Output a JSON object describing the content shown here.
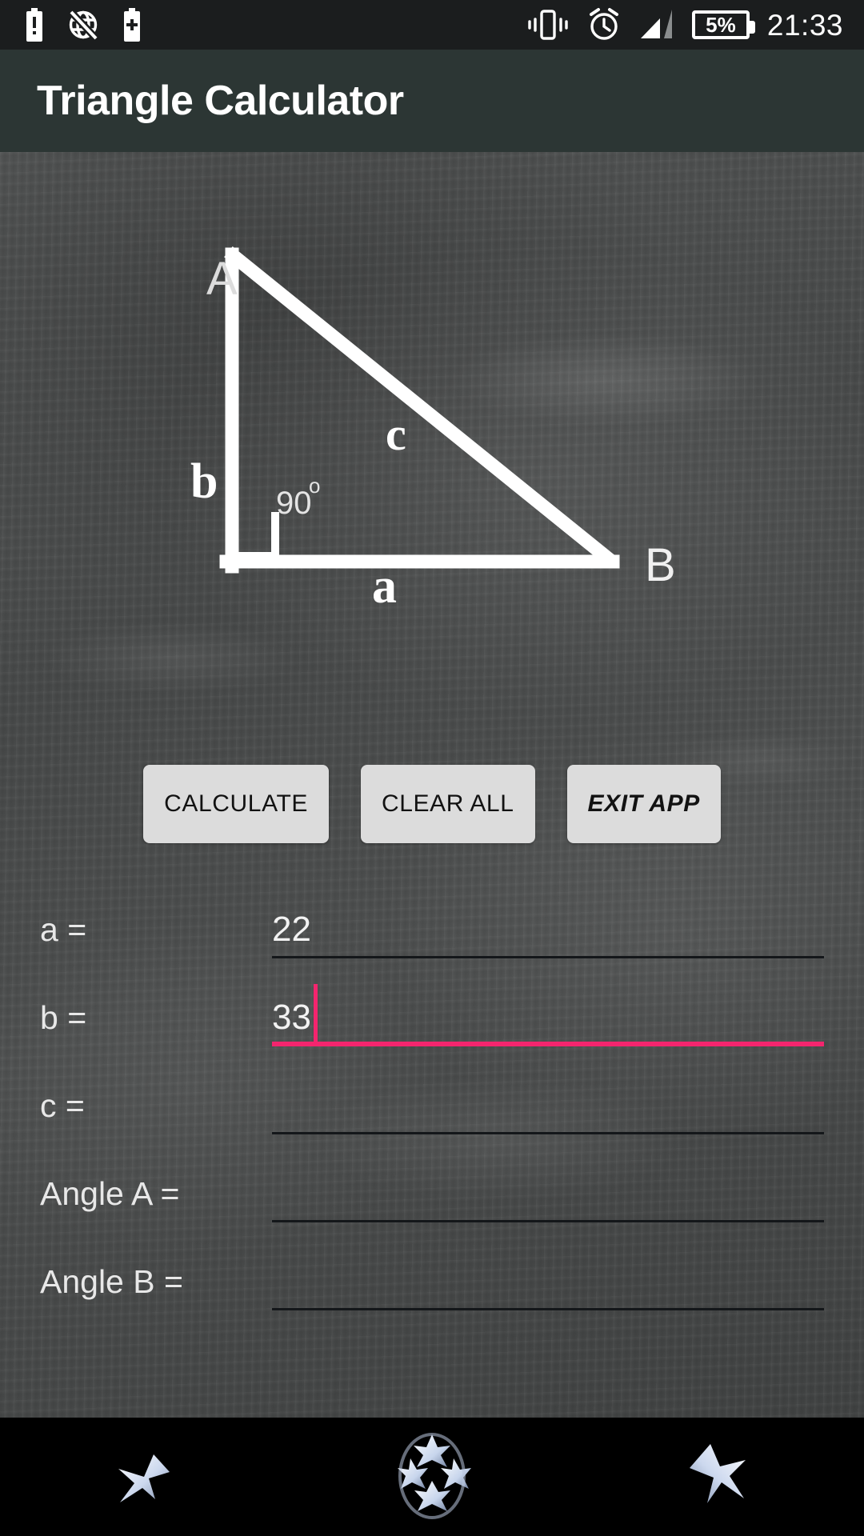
{
  "status_bar": {
    "icons_left": [
      "battery-alert-icon",
      "no-internet-icon",
      "battery-plus-icon"
    ],
    "icons_right": [
      "vibrate-icon",
      "alarm-icon",
      "signal-icon"
    ],
    "battery_percent": "5%",
    "clock": "21:33"
  },
  "app_bar": {
    "title": "Triangle Calculator"
  },
  "diagram": {
    "vertex_a": "A",
    "vertex_b": "B",
    "side_a": "a",
    "side_b": "b",
    "side_c": "c",
    "right_angle": "90",
    "degree_symbol": "o",
    "stroke_color": "#ffffff"
  },
  "buttons": [
    {
      "label": "CALCULATE",
      "name": "calculate-button",
      "italic": false
    },
    {
      "label": "CLEAR ALL",
      "name": "clear-all-button",
      "italic": false
    },
    {
      "label": "EXIT APP",
      "name": "exit-app-button",
      "italic": true
    }
  ],
  "fields": [
    {
      "label": "a =",
      "value": "22",
      "name": "field-a",
      "focused": false
    },
    {
      "label": "b =",
      "value": "33",
      "name": "field-b",
      "focused": true
    },
    {
      "label": "c =",
      "value": "",
      "name": "field-c",
      "focused": false
    },
    {
      "label": "Angle A =",
      "value": "",
      "name": "field-angle-a",
      "focused": false
    },
    {
      "label": "Angle B =",
      "value": "",
      "name": "field-angle-b",
      "focused": false
    }
  ],
  "nav_bar": {
    "items": [
      {
        "name": "back-star-icon",
        "icon": "star"
      },
      {
        "name": "home-ball-icon",
        "icon": "ball"
      },
      {
        "name": "recents-star-icon",
        "icon": "star-flipped"
      }
    ]
  },
  "colors": {
    "app_bar": "#2c3634",
    "status_bar": "#1b1d1e",
    "accent_pink": "#f4256e",
    "button_face": "#dcdcdc",
    "board": "#4b4d4d"
  }
}
